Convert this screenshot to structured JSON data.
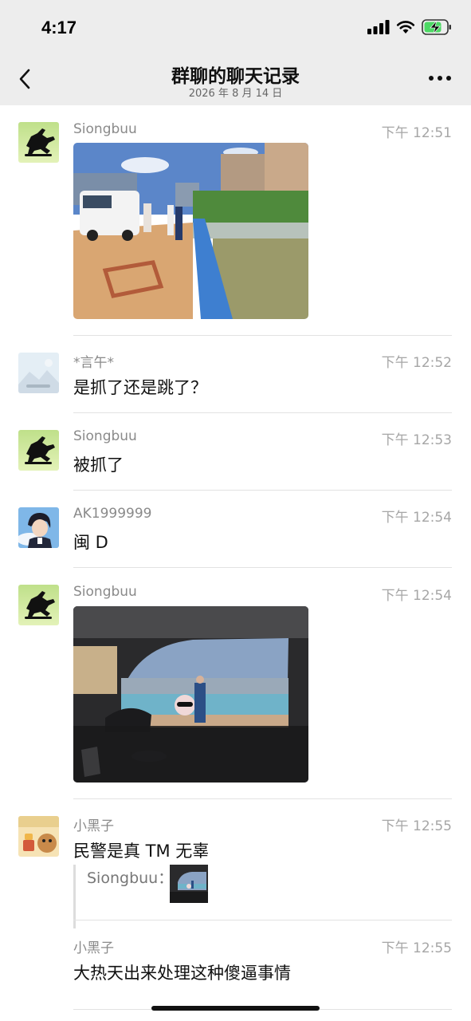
{
  "status_bar": {
    "time": "4:17"
  },
  "nav": {
    "title": "群聊的聊天记录",
    "subtitle": "2026 年 8 月 14 日"
  },
  "messages": [
    {
      "sender": "Siongbuu",
      "time": "下午 12:51",
      "type": "image"
    },
    {
      "sender": "*言午*",
      "time": "下午 12:52",
      "text": "是抓了还是跳了？"
    },
    {
      "sender": "Siongbuu",
      "time": "下午 12:53",
      "text": "被抓了"
    },
    {
      "sender": "AK1999999",
      "time": "下午 12:54",
      "text": "闽 D"
    },
    {
      "sender": "Siongbuu",
      "time": "下午 12:54",
      "type": "image"
    },
    {
      "sender": "小黑子",
      "time": "下午 12:55",
      "text": "民警是真 TM 无辜",
      "quote": {
        "name": "Siongbuu："
      }
    },
    {
      "sender": "小黑子",
      "time": "下午 12:55",
      "text": "大热天出来处理这种傻逼事情"
    }
  ]
}
